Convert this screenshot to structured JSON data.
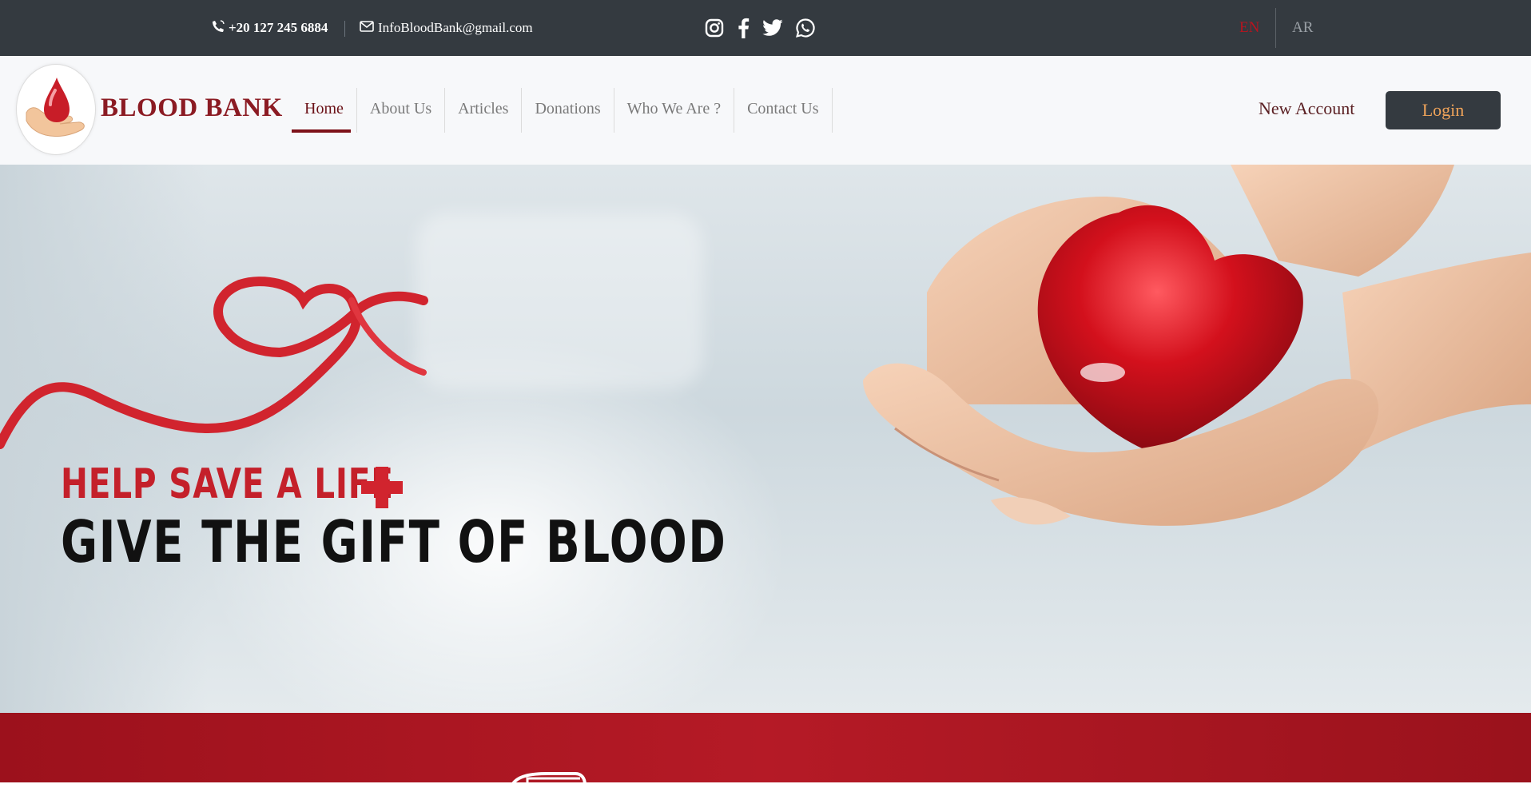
{
  "topbar": {
    "phone": "+20 127 245 6884",
    "email": "InfoBloodBank@gmail.com",
    "social_icons": [
      "instagram-icon",
      "facebook-icon",
      "twitter-icon",
      "whatsapp-icon"
    ],
    "lang_en": "EN",
    "lang_ar": "AR",
    "active_lang_color": "#b8141f",
    "bg_color": "#343a40"
  },
  "header": {
    "brand": "BLOOD BANK",
    "brand_color": "#8b1b23",
    "nav": [
      {
        "label": "Home",
        "active": true
      },
      {
        "label": "About Us"
      },
      {
        "label": "Articles"
      },
      {
        "label": "Donations"
      },
      {
        "label": "Who We Are ?"
      },
      {
        "label": "Contact Us"
      }
    ],
    "new_account": "New Account",
    "login": "Login"
  },
  "hero": {
    "line1": "HELP SAVE A LIFE",
    "line2": "GIVE THE GIFT OF BLOOD",
    "accent_color": "#c4202a"
  },
  "section_color": "#a8141f"
}
